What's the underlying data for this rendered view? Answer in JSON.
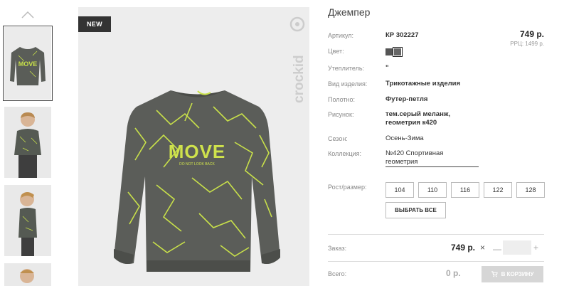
{
  "badge": "NEW",
  "brand": "crockid",
  "product": {
    "title": "Джемпер",
    "price": "749 р.",
    "rrp": "РРЦ: 1499 р.",
    "graphic_text": "MOVE",
    "graphic_subtext": "DO NOT LOOK BACK"
  },
  "attributes": {
    "article": {
      "label": "Артикул:",
      "value": "КР 302227"
    },
    "color": {
      "label": "Цвет:"
    },
    "insulation": {
      "label": "Утеплитель:",
      "value": "\""
    },
    "product_type": {
      "label": "Вид изделия:",
      "value": "Трикотажные изделия"
    },
    "fabric": {
      "label": "Полотно:",
      "value": "Футер-петля"
    },
    "pattern": {
      "label": "Рисунок:",
      "value_line1": "тем.серый меланж,",
      "value_line2": "геометрия к420"
    },
    "season": {
      "label": "Сезон:",
      "value": "Осень-Зима"
    },
    "collection": {
      "label": "Коллекция:",
      "value_line1": "№420 Спортивная",
      "value_line2": "геометрия"
    }
  },
  "colors": [
    "#555555",
    "#666666"
  ],
  "sizes": {
    "label": "Рост/размер:",
    "options": [
      "104",
      "110",
      "116",
      "122",
      "128"
    ],
    "select_all": "ВЫБРАТЬ ВСЕ"
  },
  "order": {
    "label": "Заказ:",
    "price": "749 р.",
    "times": "×",
    "minus": "—",
    "plus": "+",
    "quantity": ""
  },
  "total": {
    "label": "Всего:",
    "value": "0 р.",
    "cart_button": "В КОРЗИНУ"
  }
}
